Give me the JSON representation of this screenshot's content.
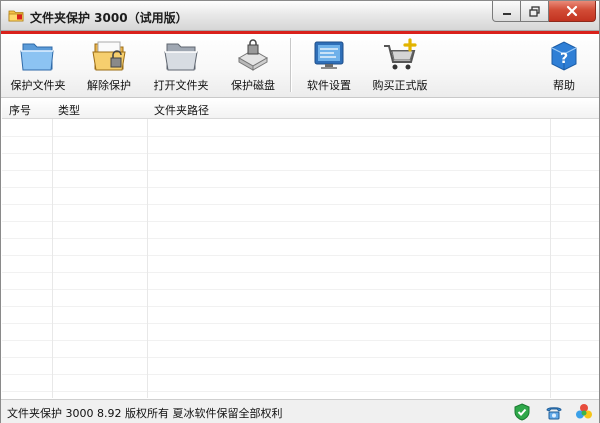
{
  "window": {
    "title": "文件夹保护 3000（试用版）"
  },
  "toolbar": {
    "items": [
      {
        "label": "保护文件夹",
        "icon": "folder-shield-icon"
      },
      {
        "label": "解除保护",
        "icon": "folder-unlock-icon"
      },
      {
        "label": "打开文件夹",
        "icon": "folder-open-icon"
      },
      {
        "label": "保护磁盘",
        "icon": "disk-lock-icon"
      },
      {
        "label": "软件设置",
        "icon": "settings-monitor-icon"
      },
      {
        "label": "购买正式版",
        "icon": "shopping-cart-icon"
      },
      {
        "label": "帮助",
        "icon": "help-icon"
      }
    ]
  },
  "table": {
    "columns": [
      "序号",
      "类型",
      "文件夹路径"
    ],
    "rows": []
  },
  "status": {
    "text": "文件夹保护 3000 8.92 版权所有 夏冰软件保留全部权利",
    "icons": [
      "shield-check-icon",
      "telephone-icon",
      "color-balls-icon"
    ]
  },
  "colors": {
    "accent": "#d9211b",
    "close_button": "#c23320"
  }
}
